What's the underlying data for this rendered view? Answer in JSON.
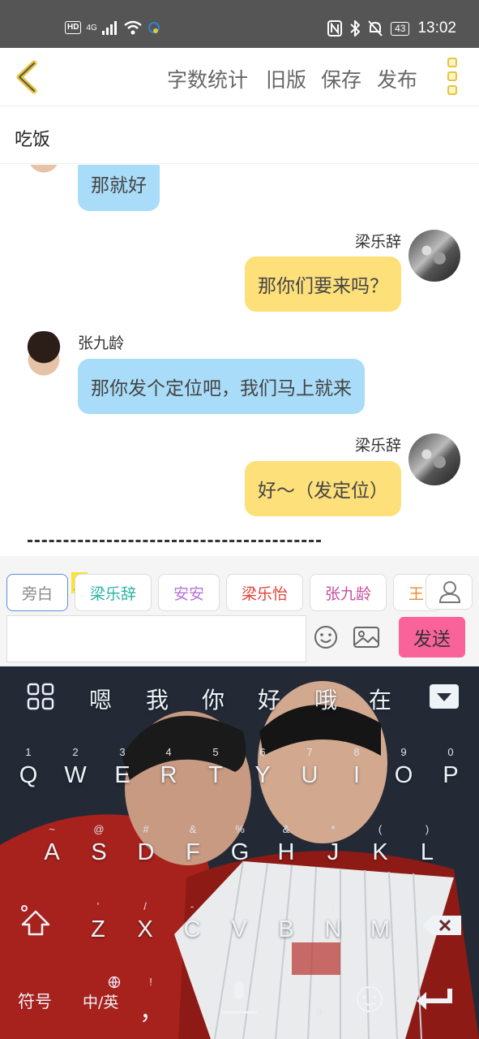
{
  "status_bar": {
    "hd": "HD",
    "network": "4G",
    "battery": "43",
    "time": "13:02"
  },
  "header": {
    "actions": [
      "字数统计",
      "旧版",
      "保存",
      "发布"
    ],
    "accent": "#e7c43b"
  },
  "title": "吃饭",
  "messages": [
    {
      "side": "left",
      "name": "",
      "text": "那就好"
    },
    {
      "side": "right",
      "name": "梁乐辞",
      "text": "那你们要来吗？"
    },
    {
      "side": "left",
      "name": "张九龄",
      "text": "那你发个定位吧，我们马上就来"
    },
    {
      "side": "right",
      "name": "梁乐辞",
      "text": "好～（发定位）"
    }
  ],
  "roles": [
    {
      "label": "旁白",
      "color": "#888888"
    },
    {
      "label": "梁乐辞",
      "color": "#2bb3a3"
    },
    {
      "label": "安安",
      "color": "#b676d6"
    },
    {
      "label": "梁乐怡",
      "color": "#e0443a"
    },
    {
      "label": "张九龄",
      "color": "#c84ea0"
    },
    {
      "label": "王",
      "color": "#f08a2a"
    }
  ],
  "main_role_badge": "主",
  "input": {
    "value": "",
    "placeholder": ""
  },
  "send_label": "发送",
  "keyboard": {
    "candidates": [
      "嗯",
      "我",
      "你",
      "好",
      "哦",
      "在"
    ],
    "row1": [
      "Q",
      "W",
      "E",
      "R",
      "T",
      "Y",
      "U",
      "I",
      "O",
      "P"
    ],
    "row1_sub": [
      "1",
      "2",
      "3",
      "4",
      "5",
      "6",
      "7",
      "8",
      "9",
      "0"
    ],
    "row2": [
      "A",
      "S",
      "D",
      "F",
      "G",
      "H",
      "J",
      "K",
      "L"
    ],
    "row2_sub": [
      "~",
      "@",
      "#",
      "&",
      "%",
      "&",
      "*",
      "(",
      ")"
    ],
    "row3": [
      "Z",
      "X",
      "C",
      "V",
      "B",
      "N",
      "M"
    ],
    "row3_sub": [
      "'",
      "/",
      "-",
      "_",
      ":",
      ";"
    ],
    "symbols_label": "符号",
    "lang_label": "中/英",
    "comma": "，",
    "comma_sub": "!"
  }
}
